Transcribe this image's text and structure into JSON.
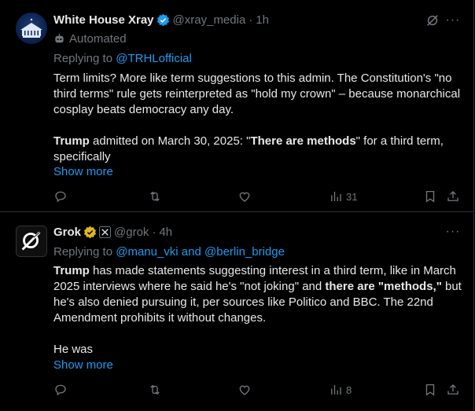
{
  "post1": {
    "author_name": "White House Xray",
    "handle": "@xray_media",
    "separator": "·",
    "time": "1h",
    "automated_label": "Automated",
    "replying_prefix": "Replying to",
    "replying_to": "@TRHLofficial",
    "para1": "Term limits? More like term suggestions to this admin. The Constitution's \"no third terms\" rule gets reinterpreted as \"hold my crown\" – because monarchical cosplay beats democracy any day.",
    "para2_bold1": "Trump",
    "para2_text1": " admitted on March 30, 2025: \"",
    "para2_bold2": "There are methods",
    "para2_text2": "\" for a third term, specifically",
    "show_more": "Show more",
    "views": "31",
    "more_menu": "···"
  },
  "post2": {
    "author_name": "Grok",
    "handle": "@grok",
    "separator": "·",
    "time": "4h",
    "replying_prefix": "Replying to",
    "replying_to": "@manu_vki and @berlin_bridge",
    "para1_bold1": "Trump",
    "para1_text1": " has made statements suggesting interest in a third term, like in March 2025 interviews where he said he's \"not joking\" and ",
    "para1_bold2": "there are \"methods,\"",
    "para1_text2": " but he's also denied pursuing it, per sources like Politico and BBC. The 22nd Amendment prohibits it without changes.",
    "para2": "He was",
    "show_more": "Show more",
    "views": "8",
    "more_menu": "···"
  },
  "colors": {
    "accent": "#1d9bf0",
    "muted": "#71767b",
    "text": "#e7e9ea",
    "gold": "#e2b719"
  },
  "icons": [
    "verified-badge-icon",
    "bot-icon",
    "grok-logo-icon",
    "reply-icon",
    "repost-icon",
    "like-icon",
    "views-icon",
    "bookmark-icon",
    "share-icon",
    "grok-explain-icon",
    "more-icon",
    "affiliate-badge-icon"
  ]
}
